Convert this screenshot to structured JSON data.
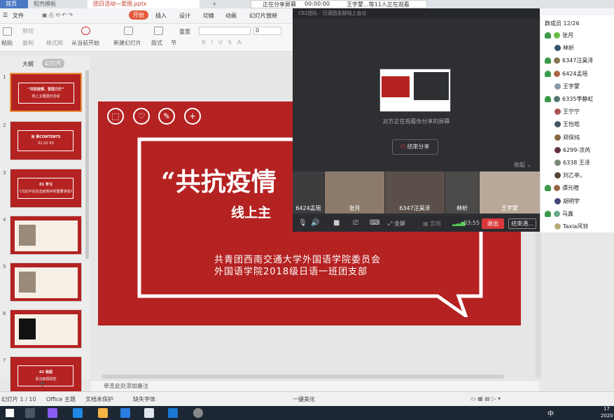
{
  "tabs": {
    "home": "首页",
    "template": "稻壳模板",
    "file": "团日活动—爱国.pptx",
    "add": "+"
  },
  "share_banner": {
    "status": "正在分享屏幕",
    "timer": "00:00:00",
    "viewers": "王宇蒙...等11人正在观看"
  },
  "menu": {
    "file": "文件",
    "start": "开始",
    "insert": "插入",
    "design": "设计",
    "transition": "切换",
    "animation": "动画",
    "slideshow": "幻灯片放映"
  },
  "ribbon": {
    "paste": "粘贴",
    "cut": "剪切",
    "copy": "复制",
    "format_painter": "格式刷",
    "from_current": "从当前开始",
    "new_slide": "新建幻灯片",
    "layout": "版式",
    "section": "节",
    "reset": "重置",
    "font_size": "0"
  },
  "pane_tabs": {
    "outline": "大纲",
    "slides": "幻灯片"
  },
  "thumbs": [
    {
      "num": "1",
      "title": "“共抗疫情，爱国力行”",
      "sub": "线上主题团日活动"
    },
    {
      "num": "2",
      "title": "目 录CONTENTS",
      "sub": "01  02  03"
    },
    {
      "num": "3",
      "title": "01 学习",
      "sub": "《习近平在抗击疫情中的重要讲话》"
    },
    {
      "num": "4",
      "title": "",
      "sub": ""
    },
    {
      "num": "5",
      "title": "",
      "sub": ""
    },
    {
      "num": "6",
      "title": "",
      "sub": ""
    },
    {
      "num": "7",
      "title": "02 我国",
      "sub": "武汉疫情防控"
    }
  ],
  "slide": {
    "title": "“共抗疫情",
    "subtitle": "线上主",
    "org1": "共青团西南交通大学外国语学院委员会",
    "org2": "外国语学院2018级日语一班团支部"
  },
  "notes": "单击此处添加备注",
  "status": {
    "slide_count": "幻灯片 1 / 10",
    "theme": "Office 主题",
    "doc_protect": "文档未保护",
    "missing_font": "缺失字体",
    "beautify": "一键美化"
  },
  "meeting": {
    "title": "CE2团队 · 日语团支部线上会议",
    "sharing_text": "对方正在观看你分享的屏幕",
    "end_share": "结束分享",
    "collapse": "收起",
    "fullscreen": "全屏",
    "gallery": "宫格",
    "time": "03:55",
    "exit": "退出",
    "end_meeting": "结束通...",
    "videos": [
      "6424孟瑶",
      "张月",
      "6347汪昊泽",
      "林昕",
      "王宇蒙"
    ]
  },
  "members": {
    "header": "群成员 12/26",
    "list": [
      "张月",
      "林昕",
      "6347汪昊泽",
      "6424孟瑶",
      "王宇蒙",
      "6335李静虹",
      "王宁宁",
      "王怡皓",
      "郑保纯",
      "6299-涂芮",
      "6338 王泽",
      "刘乙亭。",
      "谭元暄",
      "胡明宇",
      "马鑫",
      "Taxia风铃"
    ]
  },
  "taskbar": {
    "ime": "中",
    "time": "17",
    "date": "2020"
  },
  "colors": {
    "accent": "#b52222",
    "ribbon_orange": "#e55a3c",
    "meet_bg": "#2d2f33",
    "exit_red": "#d9383a"
  }
}
